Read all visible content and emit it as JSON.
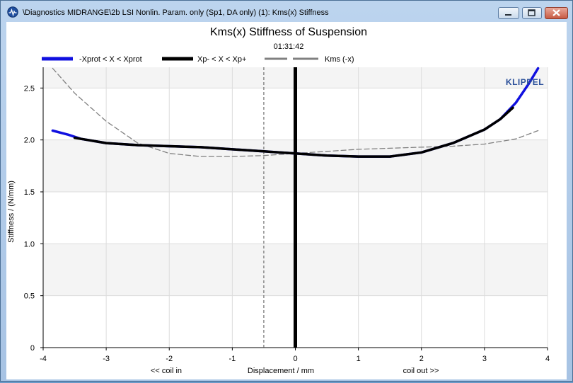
{
  "window": {
    "title": "\\Diagnostics MIDRANGE\\2b LSI Nonlin. Param. only (Sp1, DA only) (1): Kms(x) Stiffness",
    "controls": {
      "minimize_icon": "minimize-icon",
      "maximize_icon": "maximize-icon",
      "close_icon": "close-icon"
    }
  },
  "colors": {
    "series_xprot": "#1010e0",
    "series_xp": "#000000",
    "series_kms_neg": "#808080",
    "logo": "#2a4f9a",
    "plot_band": "#f4f4f4"
  },
  "logo_text": "KLIPPEL",
  "chart_data": {
    "type": "line",
    "title": "Kms(x) Stiffness of Suspension",
    "subtitle": "01:31:42",
    "xlabel": "Displacement / mm",
    "xlabel_left_hint": "<< coil in",
    "xlabel_right_hint": "coil out >>",
    "ylabel": "Stiffness / (N/mm)",
    "xlim": [
      -4,
      4
    ],
    "ylim": [
      0,
      2.7
    ],
    "xticks": [
      "-4",
      "-3",
      "-2",
      "-1",
      "0",
      "1",
      "2",
      "3",
      "4"
    ],
    "yticks": [
      "0",
      "0.5",
      "1.0",
      "1.5",
      "2.0",
      "2.5"
    ],
    "grid": true,
    "legend_position": "top",
    "vertical_markers": [
      {
        "x": 0,
        "style": "solid-thick"
      },
      {
        "x": -0.5,
        "style": "dashed"
      }
    ],
    "series": [
      {
        "name": "-Xprot < X < Xprot",
        "style": "solid-blue",
        "x": [
          -3.85,
          -3.6,
          -3.4,
          -3.2,
          -3.0,
          -2.5,
          -2.0,
          -1.5,
          -1.0,
          -0.5,
          0,
          0.5,
          1.0,
          1.5,
          2.0,
          2.5,
          3.0,
          3.25,
          3.5,
          3.7,
          3.85
        ],
        "y": [
          2.09,
          2.05,
          2.01,
          1.99,
          1.97,
          1.95,
          1.94,
          1.93,
          1.91,
          1.89,
          1.87,
          1.85,
          1.84,
          1.84,
          1.88,
          1.97,
          2.1,
          2.2,
          2.36,
          2.54,
          2.69
        ]
      },
      {
        "name": "Xp- < X < Xp+",
        "style": "solid-black",
        "x": [
          -3.5,
          -3.2,
          -3.0,
          -2.5,
          -2.0,
          -1.5,
          -1.0,
          -0.5,
          0,
          0.5,
          1.0,
          1.5,
          2.0,
          2.5,
          3.0,
          3.25,
          3.45
        ],
        "y": [
          2.02,
          1.99,
          1.97,
          1.95,
          1.94,
          1.93,
          1.91,
          1.89,
          1.87,
          1.85,
          1.84,
          1.84,
          1.88,
          1.97,
          2.1,
          2.2,
          2.31
        ]
      },
      {
        "name": "Kms (-x)",
        "style": "dashed-gray",
        "x": [
          -3.85,
          -3.5,
          -3.0,
          -2.5,
          -2.0,
          -1.5,
          -1.0,
          -0.5,
          0,
          0.5,
          1.0,
          1.5,
          2.0,
          2.5,
          3.0,
          3.5,
          3.85
        ],
        "y": [
          2.69,
          2.45,
          2.18,
          1.97,
          1.87,
          1.84,
          1.84,
          1.85,
          1.87,
          1.89,
          1.91,
          1.92,
          1.93,
          1.94,
          1.96,
          2.01,
          2.09
        ]
      }
    ]
  }
}
